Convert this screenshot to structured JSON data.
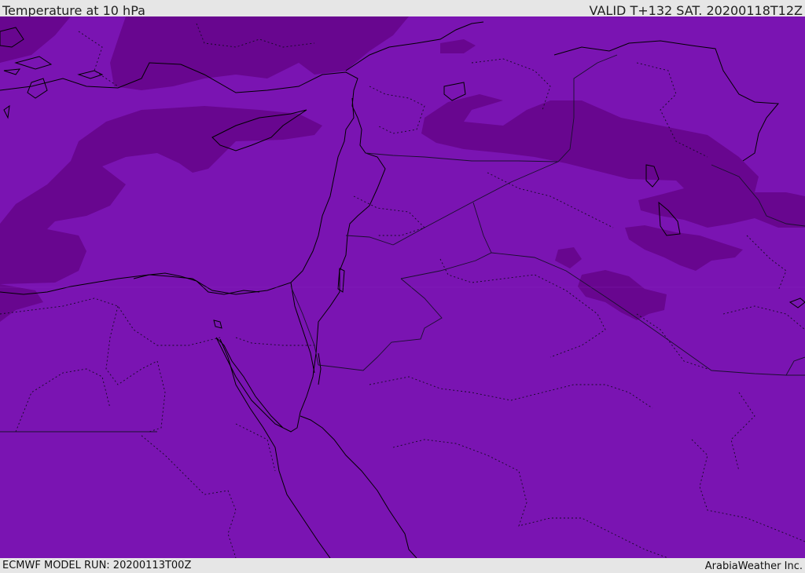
{
  "header": {
    "title": "Temperature at 10 hPa",
    "valid": "VALID T+132 SAT. 20200118T12Z"
  },
  "footer": {
    "model_run": "ECMWF MODEL RUN: 20200113T00Z",
    "credit": "ArabiaWeather Inc."
  },
  "colors": {
    "base_fill": "#7a14b2",
    "dark_fill": "#68068f",
    "coast_line": "#000000",
    "border_line": "#1a0f2e"
  }
}
